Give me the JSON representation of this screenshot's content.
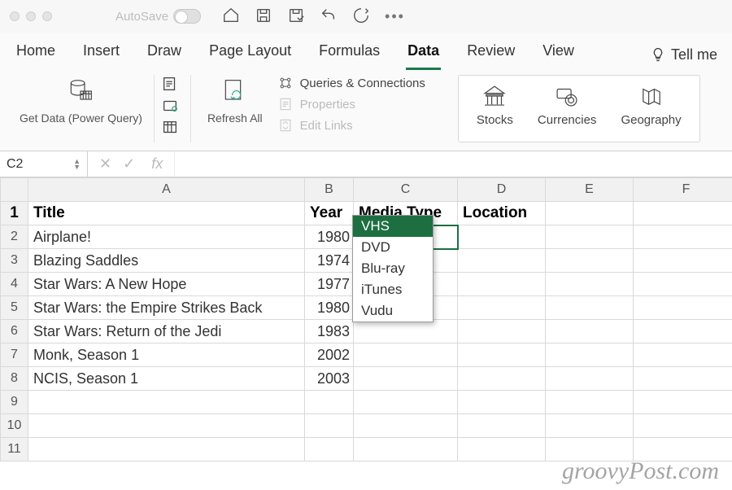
{
  "titlebar": {
    "autosave_label": "AutoSave"
  },
  "tabs": {
    "items": [
      "Home",
      "Insert",
      "Draw",
      "Page Layout",
      "Formulas",
      "Data",
      "Review",
      "View"
    ],
    "active": "Data",
    "tell_me": "Tell me"
  },
  "ribbon": {
    "get_data_label": "Get Data (Power Query)",
    "refresh_label": "Refresh All",
    "qc_items": {
      "queries": "Queries & Connections",
      "properties": "Properties",
      "edit_links": "Edit Links"
    },
    "datatypes": {
      "stocks": "Stocks",
      "currencies": "Currencies",
      "geography": "Geography"
    }
  },
  "formula_bar": {
    "namebox": "C2",
    "fx_label": "fx",
    "value": ""
  },
  "columns": [
    "A",
    "B",
    "C",
    "D",
    "E",
    "F"
  ],
  "row_numbers": [
    "1",
    "2",
    "3",
    "4",
    "5",
    "6",
    "7",
    "8",
    "9",
    "10",
    "11"
  ],
  "headers": {
    "A": "Title",
    "B": "Year",
    "C": "Media Type",
    "D": "Location"
  },
  "rows": [
    {
      "title": "Airplane!",
      "year": "1980"
    },
    {
      "title": "Blazing Saddles",
      "year": "1974"
    },
    {
      "title": "Star Wars: A New Hope",
      "year": "1977"
    },
    {
      "title": "Star Wars: the Empire Strikes Back",
      "year": "1980"
    },
    {
      "title": "Star Wars: Return of the Jedi",
      "year": "1983"
    },
    {
      "title": "Monk, Season 1",
      "year": "2002"
    },
    {
      "title": "NCIS, Season 1",
      "year": "2003"
    }
  ],
  "dropdown": {
    "options": [
      "VHS",
      "DVD",
      "Blu-ray",
      "iTunes",
      "Vudu"
    ],
    "highlighted": "VHS"
  },
  "watermark": "groovyPost.com"
}
